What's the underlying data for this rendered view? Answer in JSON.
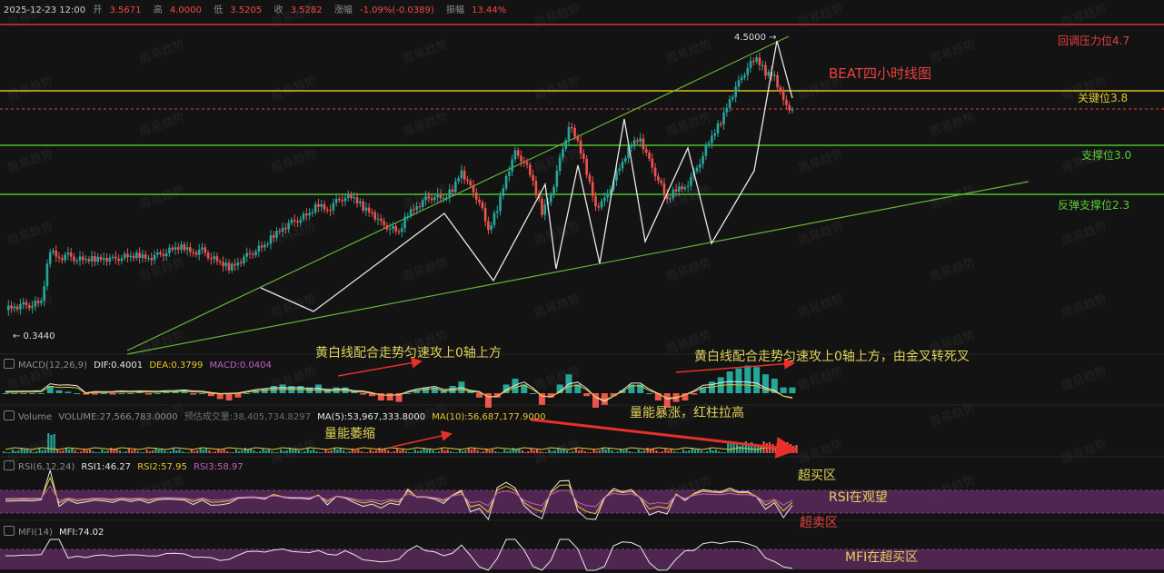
{
  "header": {
    "datetime": "2025-12-23 12:00",
    "open_label": "开",
    "open": "3.5671",
    "high_label": "高",
    "high": "4.0000",
    "low_label": "低",
    "low": "3.5205",
    "close_label": "收",
    "close": "3.5282",
    "change_label": "涨幅",
    "change": "-1.09%(-0.0389)",
    "amplitude_label": "振幅",
    "amplitude": "13.44%"
  },
  "chart_data": {
    "type": "candlestick",
    "title": "BEAT四小时线图",
    "price_high_label": "4.5000 →",
    "price_low_label": "← 0.3440",
    "levels": [
      {
        "label": "回调压力位4.7",
        "value": 4.7,
        "color": "#e03030"
      },
      {
        "label": "关键位3.8",
        "value": 3.8,
        "color": "#d8c020"
      },
      {
        "label": "支撑位3.0",
        "value": 3.0,
        "color": "#4cbf2a"
      },
      {
        "label": "反弹支撑位2.3",
        "value": 2.3,
        "color": "#4cbf2a"
      }
    ],
    "price_path": [
      0.32,
      0.33,
      0.35,
      0.36,
      0.4,
      1.26,
      1.12,
      1.16,
      1.1,
      1.08,
      1.11,
      1.12,
      1.09,
      1.14,
      1.13,
      1.17,
      1.12,
      1.16,
      1.22,
      1.27,
      1.3,
      1.21,
      1.24,
      1.13,
      1.03,
      0.97,
      1.05,
      1.15,
      1.25,
      1.31,
      1.5,
      1.61,
      1.69,
      1.77,
      1.83,
      2.0,
      1.9,
      2.03,
      2.12,
      2.08,
      1.94,
      1.86,
      1.67,
      1.62,
      1.52,
      1.85,
      1.96,
      2.07,
      2.13,
      2.07,
      2.24,
      2.54,
      2.25,
      2.05,
      1.55,
      1.93,
      2.45,
      2.82,
      2.7,
      2.35,
      1.87,
      2.14,
      2.7,
      3.27,
      3.0,
      2.52,
      1.96,
      2.05,
      2.4,
      2.66,
      2.98,
      3.06,
      2.68,
      2.4,
      2.05,
      2.25,
      2.27,
      2.48,
      2.8,
      3.08,
      3.34,
      3.7,
      3.96,
      4.23,
      4.35,
      4.13,
      4.09,
      3.64,
      3.53
    ]
  },
  "indicators": {
    "macd": {
      "name": "MACD(12,26,9)",
      "dif": "DIF:0.4001",
      "dea": "DEA:0.3799",
      "macd": "MACD:0.0404",
      "hist": [
        0,
        0,
        0,
        0,
        0,
        0.05,
        0.02,
        0.01,
        0,
        -0.01,
        -0.01,
        0,
        -0.01,
        0,
        0,
        0.01,
        -0.01,
        0,
        0.01,
        0.02,
        0.02,
        -0.01,
        0,
        -0.02,
        -0.04,
        -0.05,
        -0.03,
        0,
        0.02,
        0.03,
        0.05,
        0.06,
        0.05,
        0.05,
        0.04,
        0.06,
        0.03,
        0.04,
        0.04,
        0.02,
        -0.01,
        -0.02,
        -0.05,
        -0.05,
        -0.06,
        0,
        0.02,
        0.04,
        0.04,
        0.02,
        0.05,
        0.08,
        0.02,
        -0.03,
        -0.1,
        -0.03,
        0.06,
        0.1,
        0.06,
        0,
        -0.08,
        -0.03,
        0.06,
        0.13,
        0.06,
        -0.02,
        -0.1,
        -0.08,
        -0.02,
        0.02,
        0.06,
        0.06,
        0,
        -0.05,
        -0.1,
        -0.06,
        -0.05,
        -0.01,
        0.04,
        0.08,
        0.11,
        0.15,
        0.17,
        0.19,
        0.18,
        0.13,
        0.1,
        0.04,
        0.04
      ]
    },
    "volume": {
      "name": "Volume",
      "volume": "VOLUME:27,566,783.0000",
      "estimate": "预估成交量:38,405,734.8297",
      "ma5": "MA(5):53,967,333.8000",
      "ma10": "MA(10):56,687,177.9000"
    },
    "rsi": {
      "name": "RSI(6,12,24)",
      "rsi1": "RSI1:46.27",
      "rsi2": "RSI2:57.95",
      "rsi3": "RSI3:58.97"
    },
    "mfi": {
      "name": "MFI(14)",
      "mfi": "MFI:74.02"
    }
  },
  "annotations": {
    "macd_note_1": "黄白线配合走势匀速攻上0轴上方",
    "macd_note_2": "黄白线配合走势匀速攻上0轴上方，由金叉转死叉",
    "volume_note_1": "量能萎缩",
    "volume_note_2": "量能暴涨，红柱拉高",
    "rsi_overbought": "超买区",
    "rsi_status": "RSI在观望",
    "rsi_oversold": "超卖区",
    "mfi_status": "MFI在超买区"
  },
  "watermark": "周易趋势",
  "colors": {
    "up": "#26a69a",
    "down": "#ef5350",
    "bg": "#131313",
    "band": "#5a2a5a",
    "trend": "#64b43a"
  }
}
